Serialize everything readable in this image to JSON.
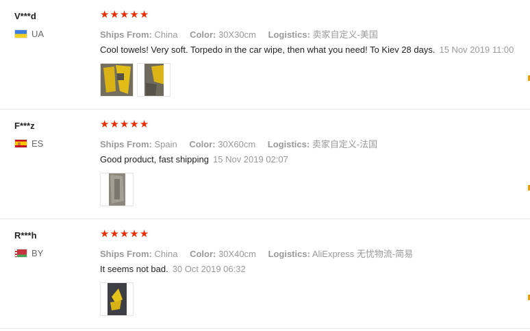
{
  "reviews": [
    {
      "user": "V***d",
      "country": "UA",
      "rating": 5,
      "ships_label": "Ships From:",
      "ships": "China",
      "color_label": "Color:",
      "color": "30X30cm",
      "logistics_label": "Logistics:",
      "logistics": "卖家自定义-美国",
      "text": "Cool towels! Very soft. Torpedo in the car wipe, then what you need! To Kiev 28 days.",
      "date": "15 Nov 2019 11:00"
    },
    {
      "user": "F***z",
      "country": "ES",
      "rating": 5,
      "ships_label": "Ships From:",
      "ships": "Spain",
      "color_label": "Color:",
      "color": "30X60cm",
      "logistics_label": "Logistics:",
      "logistics": "卖家自定义-法国",
      "text": "Good product, fast shipping",
      "date": "15 Nov 2019 02:07"
    },
    {
      "user": "R***h",
      "country": "BY",
      "rating": 5,
      "ships_label": "Ships From:",
      "ships": "China",
      "color_label": "Color:",
      "color": "30X40cm",
      "logistics_label": "Logistics:",
      "logistics": "AliExpress 无忧物流-简易",
      "text": "It seems not bad.",
      "date": "30 Oct 2019 06:32"
    }
  ],
  "colors": {
    "star": "#e62e04",
    "accent_mark": "#e6a400"
  },
  "icons": {
    "star": "star-icon"
  }
}
